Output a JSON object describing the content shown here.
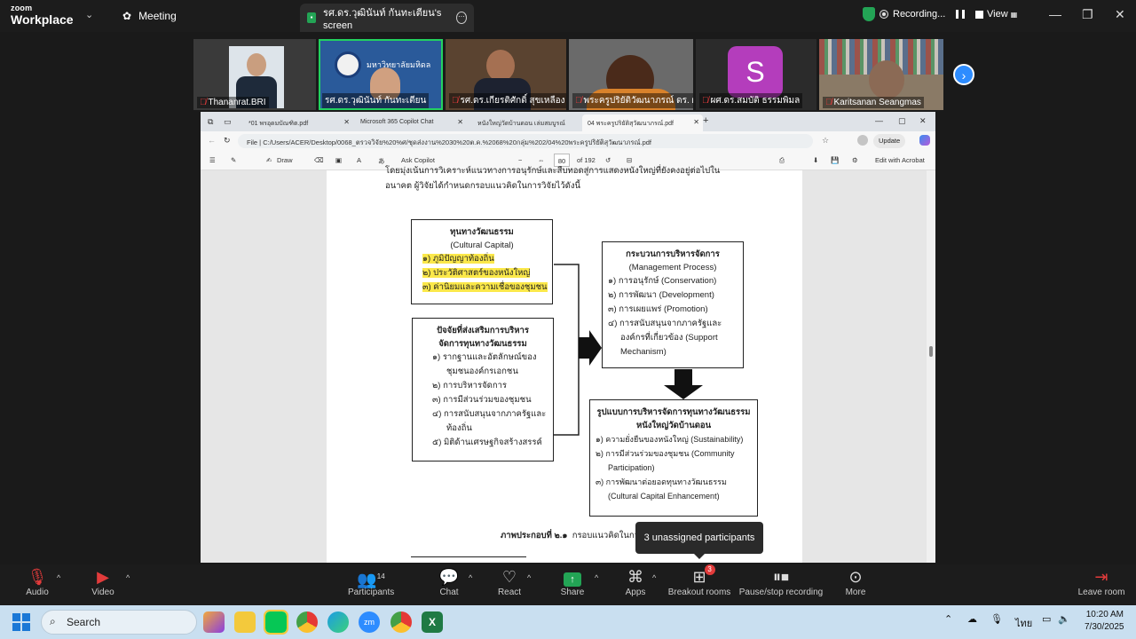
{
  "zoom_app": {
    "logo_line1": "zoom",
    "logo_line2": "Workplace",
    "meeting_label": "Meeting",
    "shared_tab_label": "รศ.ดร.วุฒินันท์ กันทะเตียน's screen",
    "recording_label": "Recording...",
    "view_label": "View"
  },
  "participants_strip": [
    {
      "name": "Thananrat.BRI",
      "muted": true
    },
    {
      "name": "รศ.ดร.วุฒินันท์ กันทะเตียน",
      "muted": false,
      "active": true
    },
    {
      "name": "รศ.ดร.เกียรติศักดิ์ สุขเหลือง",
      "muted": true
    },
    {
      "name": "พระครูปริยัติวัฒนาภรณ์ ดร. ผ...",
      "muted": true
    },
    {
      "name": "ผศ.ดร.สมบัติ ธรรมพิมล",
      "muted": true
    },
    {
      "name": "Karitsanan Seangmas",
      "muted": true
    }
  ],
  "participant_avatar_letter": "S",
  "browser": {
    "tabs": [
      {
        "label": "*01 พรอุดมบัณฑิต.pdf"
      },
      {
        "label": "Microsoft 365 Copilot Chat"
      },
      {
        "label": "หนังใหญ่วัดบ้านดอน เล่มสมบูรณ์"
      },
      {
        "label": "04 พระครูปริยัติสุวัฒนาภรณ์.pdf"
      }
    ],
    "address_prefix": "File",
    "address": "C:/Users/ACER/Desktop/0068_ตรวจวิจัย%20%ศ/ชุดส่งงาน%2030%20ต.ค.%2068%20กลุ่ม%202/04%20พระครูปริยัติสุวัฒนาภรณ์.pdf",
    "update_label": "Update",
    "draw_label": "Draw",
    "ask_copilot": "Ask Copilot",
    "page_current": "80",
    "page_total": "of 192",
    "edit_acrobat": "Edit with Acrobat"
  },
  "document": {
    "intro_line1": "โดยมุ่งเน้นการวิเคราะห์แนวทางการอนุรักษ์และสืบทอดสู่การแสดงหนังใหญ่ที่ยังคงอยู่ต่อไปใน",
    "intro_line2": "อนาคต ผู้วิจัยได้กำหนดกรอบแนวคิดในการวิจัยไว้ดังนี้",
    "box_capital": {
      "title": "ทุนทางวัฒนธรรม",
      "subtitle": "(Cultural Capital)",
      "items": [
        "๑) ภูมิปัญญาท้องถิ่น",
        "๒) ประวัติศาสตร์ของหนังใหญ่",
        "๓) ค่านิยมและความเชื่อของชุมชน"
      ]
    },
    "box_factors": {
      "title1": "ปัจจัยที่ส่งเสริมการบริหาร",
      "title2": "จัดการทุนทางวัฒนธรรม",
      "items": [
        "๑) รากฐานและอัตลักษณ์ของ",
        "ชุมชนองค์กรเอกชน",
        "๒) การบริหารจัดการ",
        "๓) การมีส่วนร่วมของชุมชน",
        "๔) การสนับสนุนจากภาครัฐและ",
        "ท้องถิ่น",
        "๕) มิติด้านเศรษฐกิจสร้างสรรค์"
      ]
    },
    "box_process": {
      "title": "กระบวนการบริหารจัดการ",
      "subtitle": "(Management Process)",
      "items": [
        "๑) การอนุรักษ์ (Conservation)",
        "๒) การพัฒนา (Development)",
        "๓) การเผยแพร่ (Promotion)",
        "๔) การสนับสนุนจากภาครัฐและ",
        "องค์กรที่เกี่ยวข้อง (Support",
        "Mechanism)"
      ]
    },
    "box_model": {
      "title1": "รูปแบบการบริหารจัดการทุนทางวัฒนธรรม",
      "title2": "หนังใหญ่วัดบ้านดอน",
      "items": [
        "๑) ความยั่งยืนของหนังใหญ่ (Sustainability)",
        "๒) การมีส่วนร่วมของชุมชน (Community",
        "Participation)",
        "๓) การพัฒนาต่อยอดทุนทางวัฒนธรรม",
        "(Cultural Capital Enhancement)"
      ]
    },
    "caption_bold": "ภาพประกอบที่ ๒.๑",
    "caption_rest": "กรอบแนวคิดในการ"
  },
  "tooltip_text": "3 unassigned participants",
  "toolbar": {
    "audio": "Audio",
    "video": "Video",
    "participants": "Participants",
    "participants_count": "14",
    "chat": "Chat",
    "react": "React",
    "share": "Share",
    "apps": "Apps",
    "breakout": "Breakout rooms",
    "breakout_badge": "3",
    "pause_stop": "Pause/stop recording",
    "more": "More",
    "leave": "Leave room"
  },
  "taskbar": {
    "search_placeholder": "Search",
    "lang": "ไทย",
    "time": "10:20 AM",
    "date": "7/30/2025"
  },
  "colors": {
    "zoom_green": "#23d160",
    "zoom_blue": "#2d8cff",
    "highlight": "#fbe84a",
    "muted_red": "#e23b3b"
  }
}
